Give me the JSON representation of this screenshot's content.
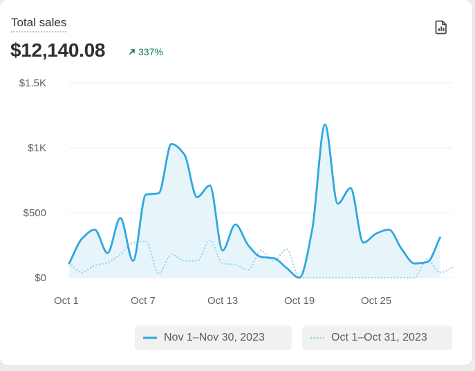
{
  "card": {
    "title": "Total sales",
    "total": "$12,140.08",
    "change": "337%",
    "change_color": "#0f7a47"
  },
  "colors": {
    "primary": "#2ea7de",
    "compare": "#8cd1ef",
    "area_fill": "#e7f5fb",
    "grid": "#ececec",
    "axis_text": "#616161"
  },
  "chart_data": {
    "type": "line",
    "ylim": [
      0,
      1500
    ],
    "y_ticks": [
      {
        "value": 0,
        "label": "$0"
      },
      {
        "value": 500,
        "label": "$500"
      },
      {
        "value": 1000,
        "label": "$1K"
      },
      {
        "value": 1500,
        "label": "$1.5K"
      }
    ],
    "x_ticks": [
      {
        "index": 0,
        "label": "Oct 1"
      },
      {
        "index": 6,
        "label": "Oct 7"
      },
      {
        "index": 12,
        "label": "Oct 13"
      },
      {
        "index": 18,
        "label": "Oct 19"
      },
      {
        "index": 24,
        "label": "Oct 25"
      }
    ],
    "grid": true,
    "legend_position": "bottom",
    "series": [
      {
        "name": "Nov 1–Nov 30, 2023",
        "style": "solid",
        "values": [
          110,
          300,
          370,
          190,
          460,
          130,
          640,
          650,
          1030,
          950,
          620,
          710,
          210,
          410,
          250,
          160,
          150,
          75,
          0,
          370,
          1180,
          570,
          690,
          270,
          340,
          370,
          220,
          110,
          120,
          310
        ]
      },
      {
        "name": "Oct 1–Oct 31, 2023",
        "style": "dotted",
        "values": [
          110,
          40,
          95,
          115,
          180,
          270,
          280,
          30,
          180,
          130,
          130,
          290,
          110,
          100,
          60,
          210,
          130,
          220,
          0,
          0,
          0,
          0,
          0,
          0,
          0,
          0,
          0,
          0,
          140,
          40,
          80
        ]
      }
    ]
  }
}
